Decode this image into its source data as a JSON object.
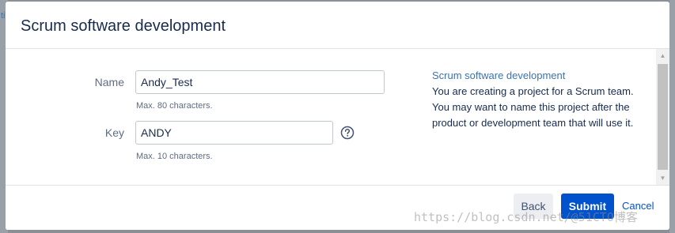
{
  "backdrop": {
    "fragment": "ti"
  },
  "dialog": {
    "title": "Scrum software development",
    "form": {
      "name": {
        "label": "Name",
        "value": "Andy_Test",
        "help": "Max. 80 characters."
      },
      "key": {
        "label": "Key",
        "value": "ANDY",
        "help": "Max. 10 characters."
      }
    },
    "info": {
      "title": "Scrum software development",
      "text": "You are creating a project for a Scrum team. You may want to name this project after the product or development team that will use it."
    },
    "footer": {
      "back_label": "Back",
      "submit_label": "Submit",
      "cancel_label": "Cancel"
    }
  },
  "watermark": "https://blog.csdn.net/@51CTO博客",
  "colors": {
    "link": "#3b73af",
    "primary": "#0052cc",
    "text": "#172b4d",
    "muted": "#5e6c84"
  },
  "icons": [
    "help-icon",
    "scroll-up-arrow-icon",
    "scroll-down-arrow-icon"
  ]
}
